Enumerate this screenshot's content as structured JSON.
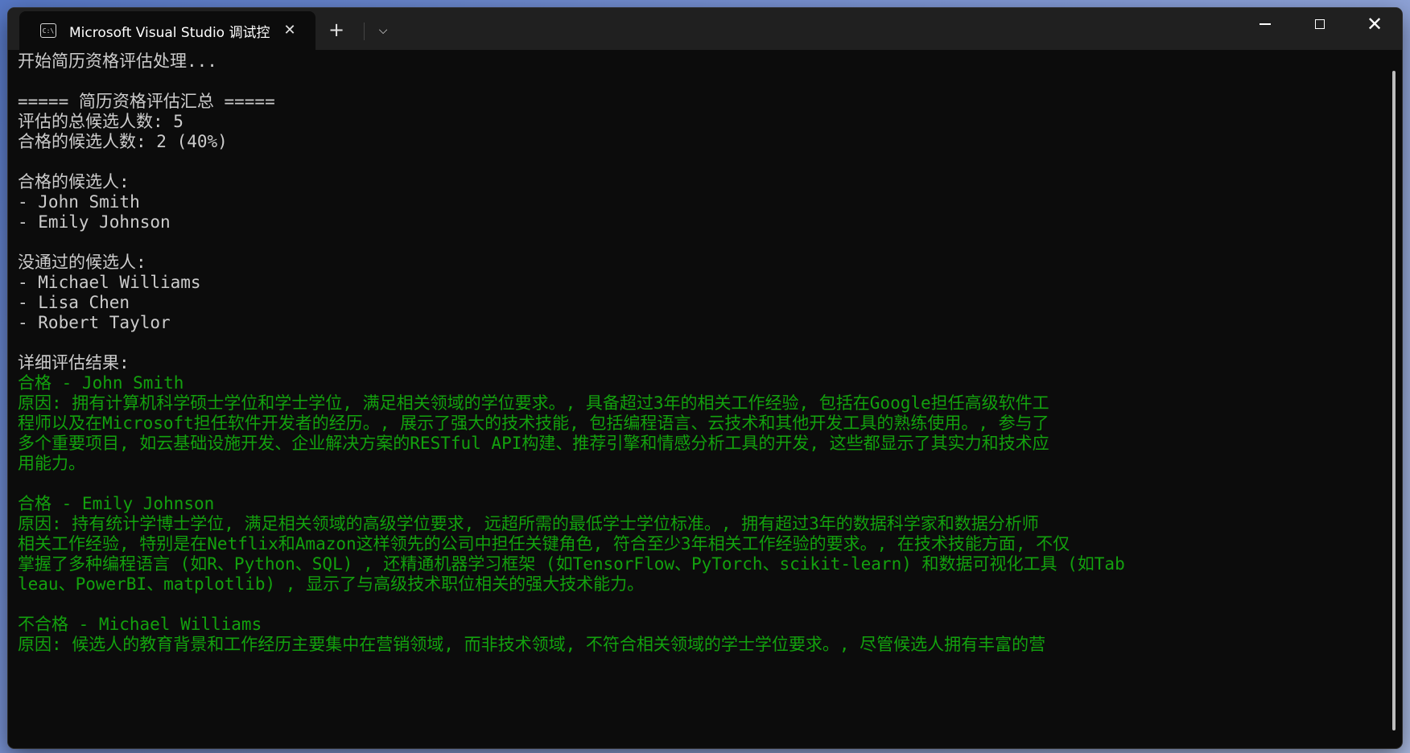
{
  "window": {
    "tab_title": "Microsoft Visual Studio 调试控制台",
    "icon": "console-icon",
    "new_tab": "+",
    "dropdown": "⌄",
    "close_tab": "✕"
  },
  "console": {
    "lines": [
      {
        "text": "开始简历资格评估处理...",
        "color": "white"
      },
      {
        "text": "",
        "color": "white"
      },
      {
        "text": "===== 简历资格评估汇总 =====",
        "color": "white"
      },
      {
        "text": "评估的总候选人数: 5",
        "color": "white"
      },
      {
        "text": "合格的候选人数: 2 (40%)",
        "color": "white"
      },
      {
        "text": "",
        "color": "white"
      },
      {
        "text": "合格的候选人:",
        "color": "white"
      },
      {
        "text": "- John Smith",
        "color": "white"
      },
      {
        "text": "- Emily Johnson",
        "color": "white"
      },
      {
        "text": "",
        "color": "white"
      },
      {
        "text": "没通过的候选人:",
        "color": "white"
      },
      {
        "text": "- Michael Williams",
        "color": "white"
      },
      {
        "text": "- Lisa Chen",
        "color": "white"
      },
      {
        "text": "- Robert Taylor",
        "color": "white"
      },
      {
        "text": "",
        "color": "white"
      },
      {
        "text": "详细评估结果:",
        "color": "white"
      },
      {
        "text": "合格 - John Smith",
        "color": "green"
      },
      {
        "text": "原因: 拥有计算机科学硕士学位和学士学位, 满足相关领域的学位要求。, 具备超过3年的相关工作经验, 包括在Google担任高级软件工",
        "color": "green"
      },
      {
        "text": "程师以及在Microsoft担任软件开发者的经历。, 展示了强大的技术技能, 包括编程语言、云技术和其他开发工具的熟练使用。, 参与了",
        "color": "green"
      },
      {
        "text": "多个重要项目, 如云基础设施开发、企业解决方案的RESTful API构建、推荐引擎和情感分析工具的开发, 这些都显示了其实力和技术应",
        "color": "green"
      },
      {
        "text": "用能力。",
        "color": "green"
      },
      {
        "text": "",
        "color": "green"
      },
      {
        "text": "合格 - Emily Johnson",
        "color": "green"
      },
      {
        "text": "原因: 持有统计学博士学位, 满足相关领域的高级学位要求, 远超所需的最低学士学位标准。, 拥有超过3年的数据科学家和数据分析师",
        "color": "green"
      },
      {
        "text": "相关工作经验, 特别是在Netflix和Amazon这样领先的公司中担任关键角色, 符合至少3年相关工作经验的要求。, 在技术技能方面, 不仅",
        "color": "green"
      },
      {
        "text": "掌握了多种编程语言 (如R、Python、SQL) , 还精通机器学习框架 (如TensorFlow、PyTorch、scikit-learn) 和数据可视化工具 (如Tab",
        "color": "green"
      },
      {
        "text": "leau、PowerBI、matplotlib) , 显示了与高级技术职位相关的强大技术能力。",
        "color": "green"
      },
      {
        "text": "",
        "color": "green"
      },
      {
        "text": "不合格 - Michael Williams",
        "color": "green"
      },
      {
        "text": "原因: 候选人的教育背景和工作经历主要集中在营销领域, 而非技术领域, 不符合相关领域的学士学位要求。, 尽管候选人拥有丰富的营",
        "color": "green"
      }
    ]
  }
}
